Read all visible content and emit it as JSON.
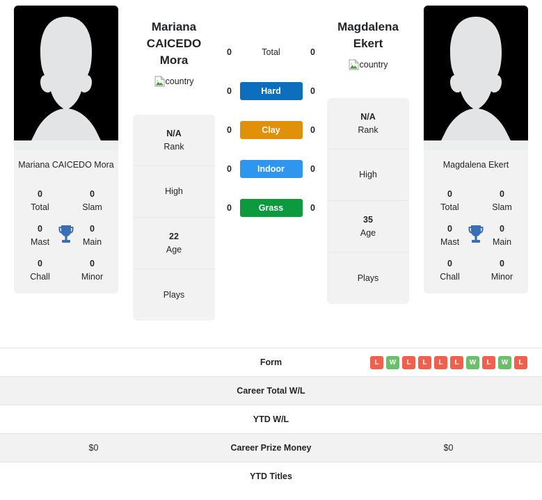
{
  "players": {
    "left": {
      "display_name_line1": "Mariana",
      "display_name_line2": "CAICEDO Mora",
      "card_name": "Mariana CAICEDO Mora",
      "country_alt": "country",
      "rank_value": "N/A",
      "rank_label": "Rank",
      "high_label": "High",
      "high_value": "",
      "age_value": "22",
      "age_label": "Age",
      "plays_label": "Plays",
      "plays_value": "",
      "titles": {
        "total_value": "0",
        "total_label": "Total",
        "slam_value": "0",
        "slam_label": "Slam",
        "mast_value": "0",
        "mast_label": "Mast",
        "main_value": "0",
        "main_label": "Main",
        "chall_value": "0",
        "chall_label": "Chall",
        "minor_value": "0",
        "minor_label": "Minor"
      }
    },
    "right": {
      "display_name_line1": "Magdalena",
      "display_name_line2": "Ekert",
      "card_name": "Magdalena Ekert",
      "country_alt": "country",
      "rank_value": "N/A",
      "rank_label": "Rank",
      "high_label": "High",
      "high_value": "",
      "age_value": "35",
      "age_label": "Age",
      "plays_label": "Plays",
      "plays_value": "",
      "titles": {
        "total_value": "0",
        "total_label": "Total",
        "slam_value": "0",
        "slam_label": "Slam",
        "mast_value": "0",
        "mast_label": "Mast",
        "main_value": "0",
        "main_label": "Main",
        "chall_value": "0",
        "chall_label": "Chall",
        "minor_value": "0",
        "minor_label": "Minor"
      }
    }
  },
  "surfaces": [
    {
      "label": "Total",
      "left": "0",
      "right": "0",
      "color": "transparent",
      "plain": true
    },
    {
      "label": "Hard",
      "left": "0",
      "right": "0",
      "color": "#0d6ebd",
      "plain": false
    },
    {
      "label": "Clay",
      "left": "0",
      "right": "0",
      "color": "#e09109",
      "plain": false
    },
    {
      "label": "Indoor",
      "left": "0",
      "right": "0",
      "color": "#2f96ef",
      "plain": false
    },
    {
      "label": "Grass",
      "left": "0",
      "right": "0",
      "color": "#0d9a3f",
      "plain": false
    }
  ],
  "table": {
    "rows": [
      {
        "label": "Form",
        "left_value": "",
        "right_value": "",
        "left_form": [],
        "right_form": [
          "L",
          "W",
          "L",
          "L",
          "L",
          "L",
          "W",
          "L",
          "W",
          "L"
        ],
        "shaded": false
      },
      {
        "label": "Career Total W/L",
        "left_value": "",
        "right_value": "",
        "shaded": true
      },
      {
        "label": "YTD W/L",
        "left_value": "",
        "right_value": "",
        "shaded": false
      },
      {
        "label": "Career Prize Money",
        "left_value": "$0",
        "right_value": "$0",
        "shaded": true
      },
      {
        "label": "YTD Titles",
        "left_value": "",
        "right_value": "",
        "shaded": false
      }
    ]
  },
  "colors": {
    "hard": "#0d6ebd",
    "clay": "#e09109",
    "indoor": "#2f96ef",
    "grass": "#0d9a3f",
    "win_badge": "#6abf69",
    "loss_badge": "#f0604d",
    "card_bg": "#f2f2f2",
    "trophy": "#3b6fb5"
  },
  "icons": {
    "trophy": "trophy-icon",
    "country_flag": "broken-image-icon"
  }
}
